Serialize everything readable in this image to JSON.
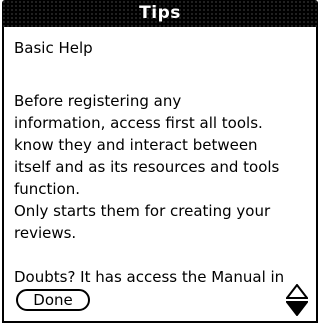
{
  "dialog": {
    "title": "Tips",
    "heading": "Basic Help",
    "paragraphs": [
      "Before registering any",
      "information, access first all tools.",
      "know they and  interact between",
      "itself and as its resources and tools",
      "function.",
      "Only starts them for creating your",
      "reviews.",
      "",
      "Doubts? It has access the Manual in"
    ],
    "done_label": "Done"
  },
  "icons": {
    "scroll": "scroll-up-down-arrows-icon"
  }
}
